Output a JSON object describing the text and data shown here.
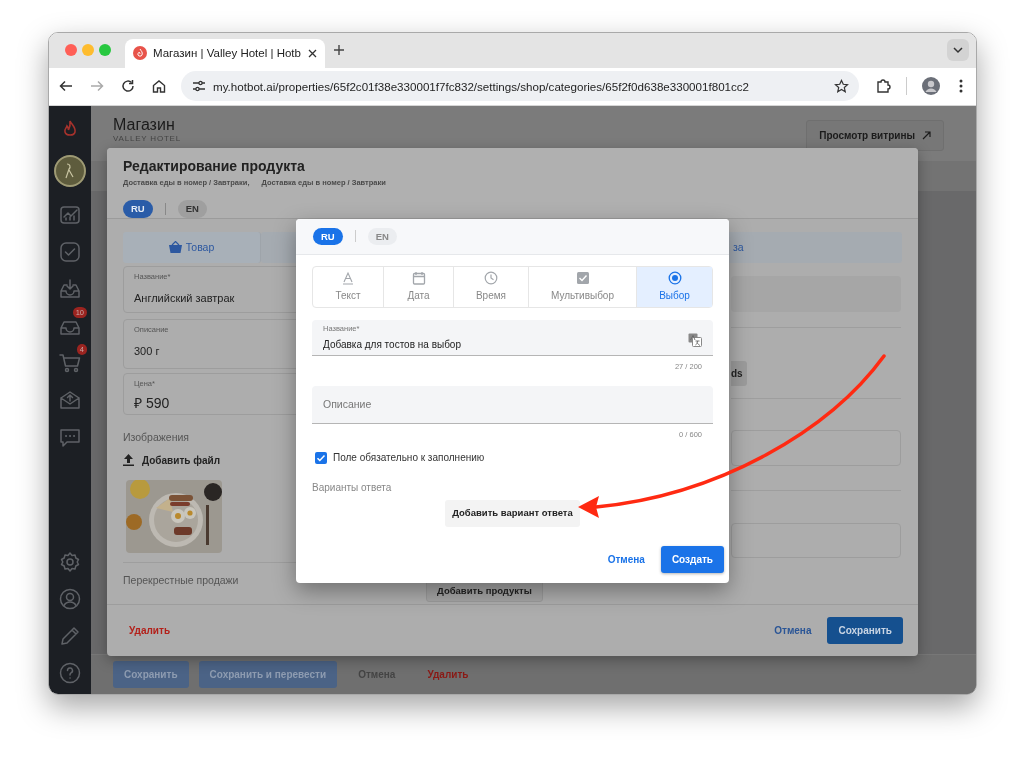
{
  "browser": {
    "tab_title": "Магазин | Valley Hotel | Hotb",
    "url": "my.hotbot.ai/properties/65f2c01f38e330001f7fc832/settings/shop/categories/65f2f0d638e330001f801cc2"
  },
  "sidebar": {
    "requests_badge": "10",
    "cart_badge": "4"
  },
  "page": {
    "title": "Магазин",
    "subtitle": "VALLEY HOTEL",
    "storefront_button": "Просмотр витрины"
  },
  "product_modal": {
    "title": "Редактирование продукта",
    "breadcrumbs": [
      "Доставка еды в номер / Завтраки,",
      "Доставка еды в номер / Завтраки"
    ],
    "languages": [
      {
        "label": "RU",
        "selected": true
      },
      {
        "label": "EN",
        "selected": false
      }
    ],
    "tabs": [
      "Товар",
      "за"
    ],
    "fields": [
      {
        "label": "Название*",
        "value": "Английский завтрак"
      },
      {
        "label": "Описание",
        "value": "300 г"
      },
      {
        "label": "Цена*",
        "value": "₽ 590"
      }
    ],
    "images_label": "Изображения",
    "add_file": "Добавить файл",
    "cross_sales_label": "Перекрестные продажи",
    "add_products": "Добавить продукты",
    "partial_button": "ds",
    "delete": "Удалить",
    "cancel": "Отмена",
    "save": "Сохранить"
  },
  "bottom_bar": {
    "buttons": [
      {
        "label": "Сохранить",
        "kind": "primary"
      },
      {
        "label": "Сохранить и перевести",
        "kind": "primary"
      },
      {
        "label": "Отмена",
        "kind": "plain"
      },
      {
        "label": "Удалить",
        "kind": "danger"
      }
    ]
  },
  "dialog": {
    "languages": [
      {
        "label": "RU",
        "selected": true
      },
      {
        "label": "EN",
        "selected": false
      }
    ],
    "field_types": [
      {
        "label": "Текст",
        "selected": false
      },
      {
        "label": "Дата",
        "selected": false
      },
      {
        "label": "Время",
        "selected": false
      },
      {
        "label": "Мультивыбор",
        "selected": false
      },
      {
        "label": "Выбор",
        "selected": true
      }
    ],
    "name_field": {
      "label": "Название*",
      "value": "Добавка для тостов на выбор",
      "counter": "27 / 200"
    },
    "description_field": {
      "label": "Описание",
      "counter": "0 / 600"
    },
    "required": {
      "label": "Поле обязательно к заполнению",
      "checked": true
    },
    "options_label": "Варианты ответа",
    "add_option": "Добавить вариант ответа",
    "cancel": "Отмена",
    "create": "Создать"
  }
}
